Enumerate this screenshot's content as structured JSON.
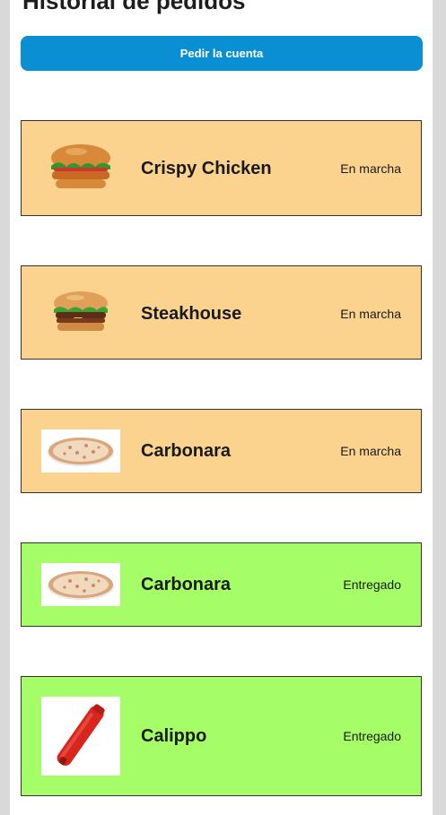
{
  "header": {
    "title": "Historial de pedidos",
    "account_button_label": "Pedir la cuenta"
  },
  "orders": [
    {
      "name": "Crispy Chicken",
      "status": "En marcha",
      "image": "crispy-chicken-burger-image"
    },
    {
      "name": "Steakhouse",
      "status": "En marcha",
      "image": "steakhouse-burger-image"
    },
    {
      "name": "Carbonara",
      "status": "En marcha",
      "image": "carbonara-pizza-image"
    },
    {
      "name": "Carbonara",
      "status": "Entregado",
      "image": "carbonara-pizza-image"
    },
    {
      "name": "Calippo",
      "status": "Entregado",
      "image": "calippo-icecream-image"
    }
  ],
  "colors": {
    "pending_bg": "#fbd38f",
    "delivered_bg": "#a5fe67",
    "button_bg": "#0b8fd3"
  }
}
